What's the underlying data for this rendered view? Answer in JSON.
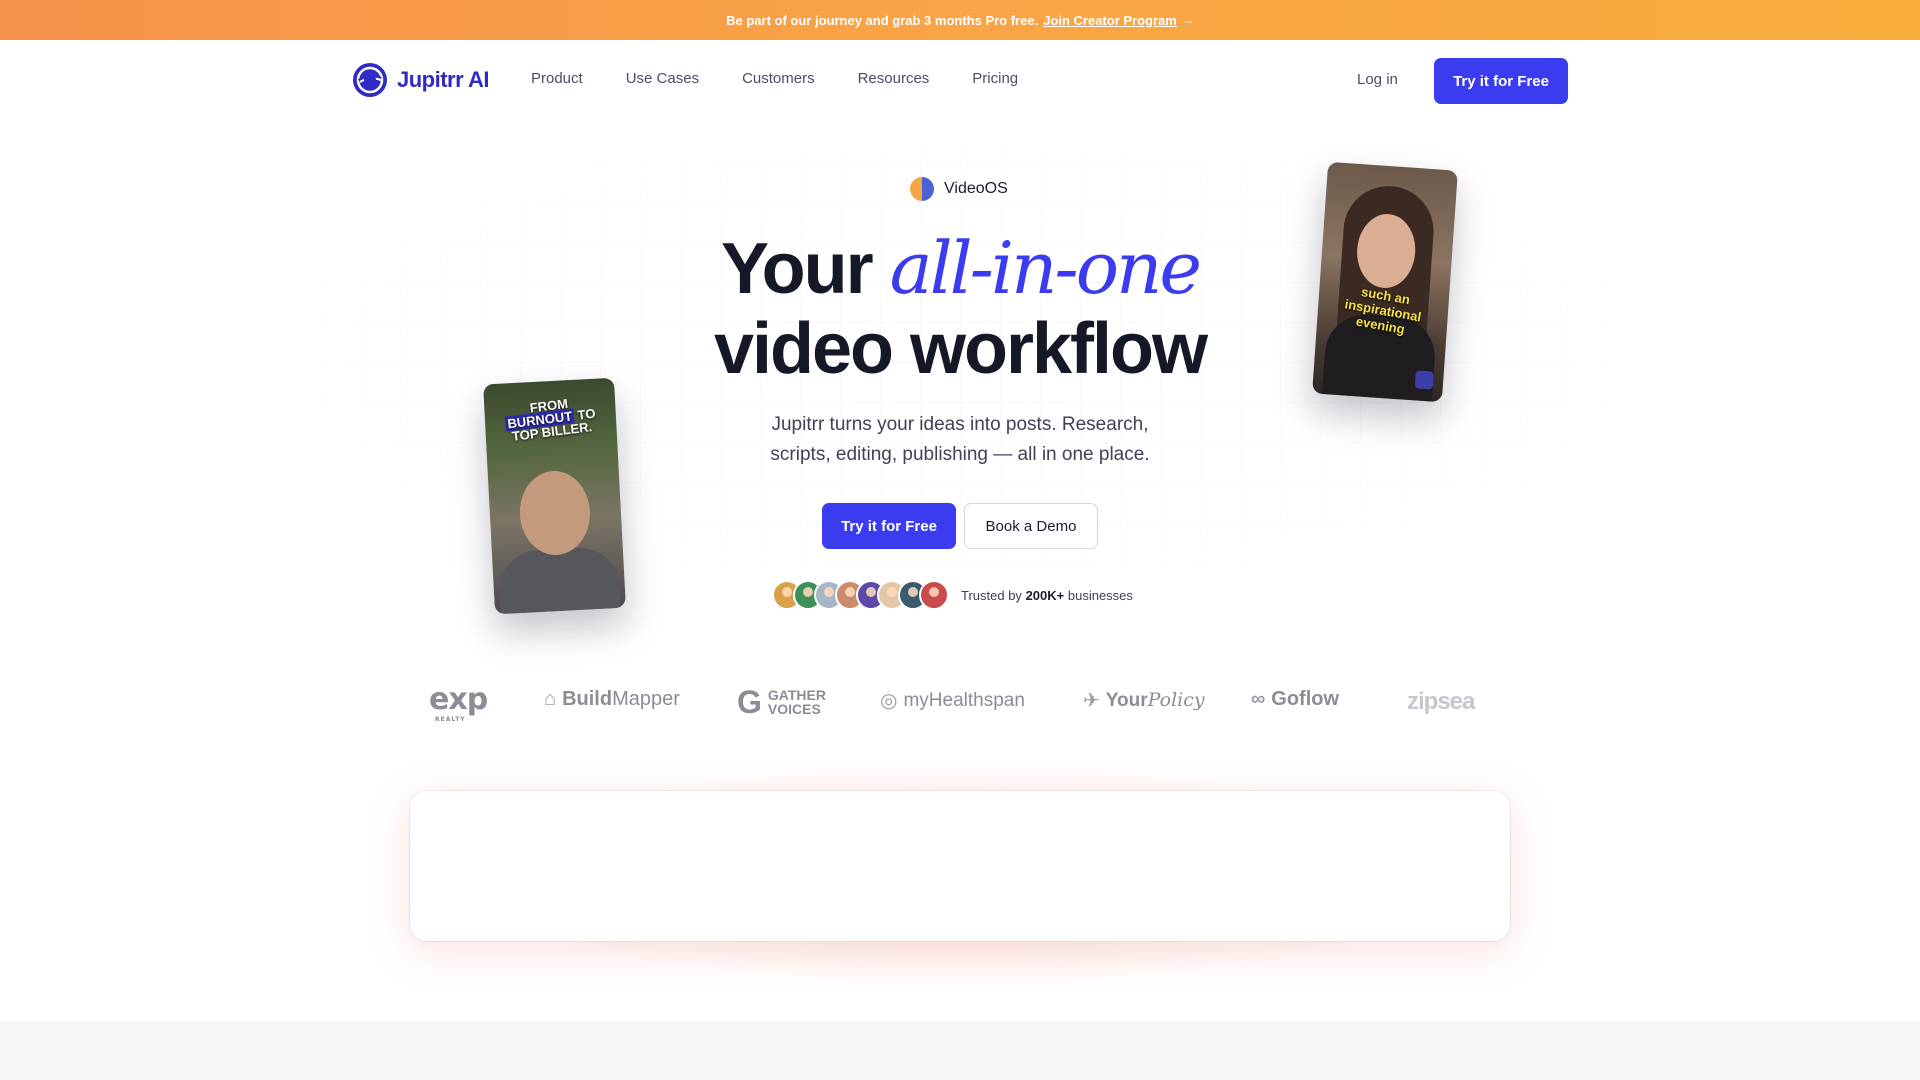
{
  "announcement": {
    "text": "Be part of our journey and grab 3 months Pro free.",
    "link": "Join Creator Program",
    "arrow": "→"
  },
  "nav": {
    "logo_text": "Jupitrr AI",
    "links": [
      "Product",
      "Use Cases",
      "Customers",
      "Resources",
      "Pricing"
    ],
    "login": "Log in",
    "cta": "Try it for Free"
  },
  "hero": {
    "badge": "VideoOS",
    "headline_1": "Your",
    "headline_accent": "all-in-one",
    "headline_2": "video workflow",
    "subheading": "Jupitrr turns your ideas into posts. Research, scripts, editing, publishing — all in one place.",
    "cta_primary": "Try it for Free",
    "cta_secondary": "Book a Demo",
    "trust_prefix": "Trusted by",
    "trust_count": "200K+",
    "trust_suffix": "businesses"
  },
  "video_cards": {
    "left_caption_1": "FROM",
    "left_caption_highlight": "BURNOUT",
    "left_caption_2": "TO",
    "left_caption_3": "TOP BILLER.",
    "right_caption": "such an inspirational evening"
  },
  "avatar_colors": [
    "#d9a24a",
    "#3f8f5b",
    "#a7b6c7",
    "#c98b6a",
    "#5b4aa8",
    "#e2c7a8",
    "#3a5a6e",
    "#c94b4b"
  ],
  "logos": {
    "exp": "exp",
    "exp_sub": "REALTY",
    "buildmapper_bold": "Build",
    "buildmapper_light": "Mapper",
    "gather_1": "GATHER",
    "gather_2": "VOICES",
    "myhealthspan": "myHealthspan",
    "yourpolicy_1": "Your",
    "yourpolicy_2": "Policy",
    "goflow": "Goflow",
    "zipsea": "zipsea"
  },
  "colors": {
    "brand": "#3b3bf0",
    "announce_start": "#f7924a",
    "announce_end": "#f8ad3c"
  }
}
